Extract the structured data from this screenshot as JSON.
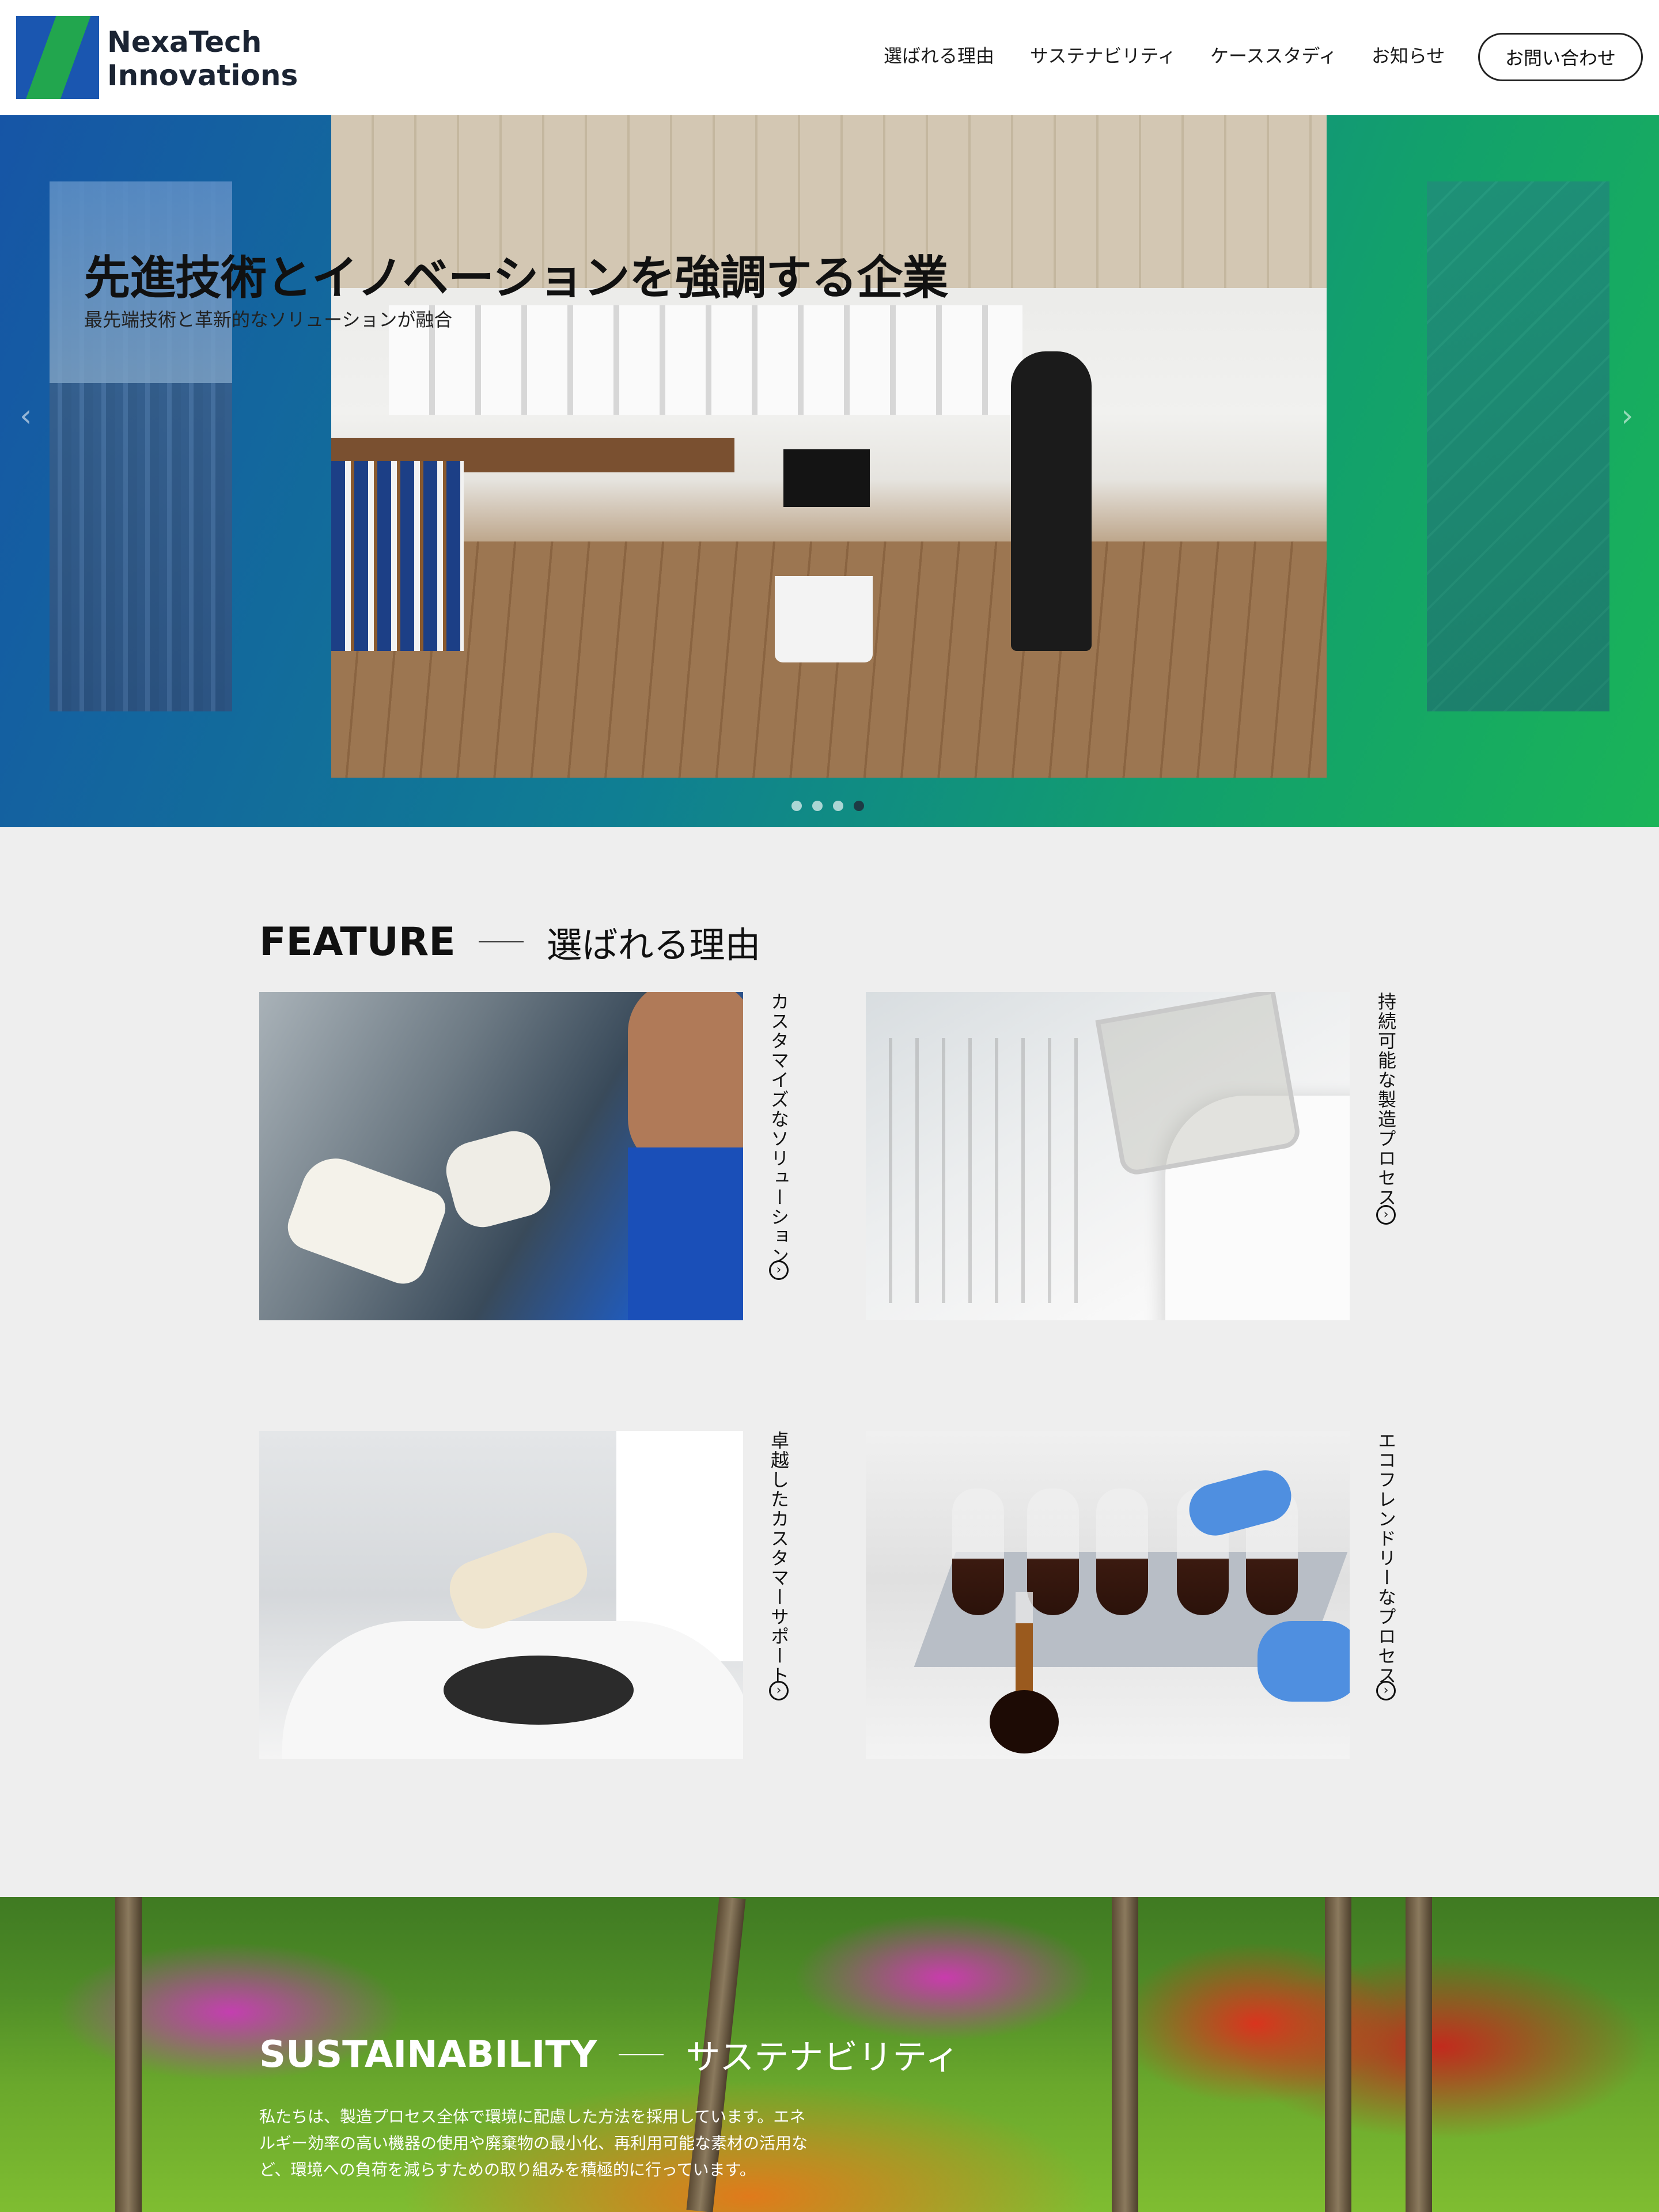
{
  "header": {
    "brand_line1": "NexaTech",
    "brand_line2": "Innovations",
    "nav": [
      "選ばれる理由",
      "サステナビリティ",
      "ケーススタディ",
      "お知らせ"
    ],
    "contact_label": "お問い合わせ"
  },
  "hero": {
    "title": "先進技術とイノベーションを強調する企業",
    "subtitle": "最先端技術と革新的なソリューションが融合",
    "prev_glyph": "‹",
    "next_glyph": "›",
    "slide_count": 4,
    "active_slide": 4
  },
  "feature": {
    "heading_en": "FEATURE",
    "heading_ja": "選ばれる理由",
    "items": [
      {
        "label": "カスタマイズなソリューション"
      },
      {
        "label": "持続可能な製造プロセス"
      },
      {
        "label": "卓越したカスタマーサポート"
      },
      {
        "label": "エコフレンドリーなプロセス"
      }
    ],
    "arrow_glyph": "›"
  },
  "sustainability": {
    "heading_en": "SUSTAINABILITY",
    "heading_ja": "サステナビリティ",
    "body": "私たちは、製造プロセス全体で環境に配慮した方法を採用しています。エネルギー効率の高い機器の使用や廃棄物の最小化、再利用可能な素材の活用など、環境への負荷を減らすための取り組みを積極的に行っています。"
  },
  "colors": {
    "brand_blue": "#1a56b0",
    "brand_green": "#22a64e",
    "page_bg": "#eeeeee"
  },
  "icons": [
    "logo-mark",
    "chevron-left-icon",
    "chevron-right-icon",
    "circle-arrow-icon"
  ]
}
